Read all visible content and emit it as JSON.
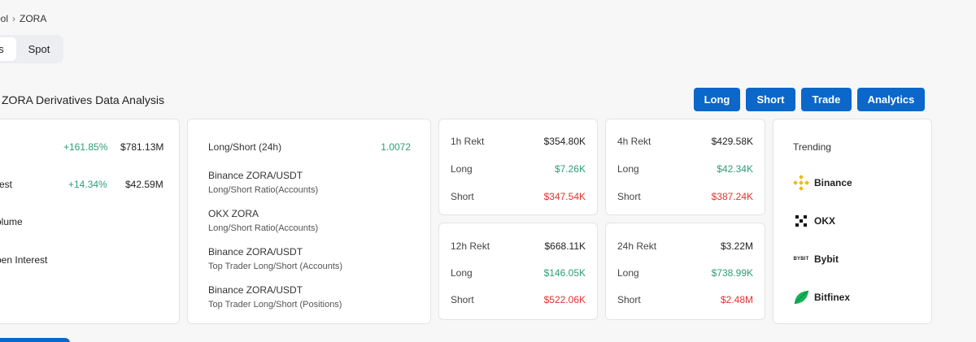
{
  "breadcrumb": {
    "parent": "ool",
    "sep": "›",
    "current": "ZORA"
  },
  "tabs": {
    "derivatives": "s",
    "spot": "Spot"
  },
  "title": "ZORA Derivatives Data Analysis",
  "buttons": {
    "long": "Long",
    "short": "Short",
    "trade": "Trade",
    "analytics": "Analytics"
  },
  "overview": [
    {
      "label": "",
      "change": "+161.85%",
      "value": "$781.13M"
    },
    {
      "label": "rest",
      "change": "+14.34%",
      "value": "$42.59M"
    },
    {
      "label": "olume"
    },
    {
      "label": "pen Interest"
    }
  ],
  "ratios": {
    "summary_label": "Long/Short (24h)",
    "summary_value": "1.0072",
    "items": [
      {
        "title": "Binance ZORA/USDT",
        "sub": "Long/Short Ratio(Accounts)"
      },
      {
        "title": "OKX ZORA",
        "sub": "Long/Short Ratio(Accounts)"
      },
      {
        "title": "Binance ZORA/USDT",
        "sub": "Top Trader Long/Short (Accounts)"
      },
      {
        "title": "Binance ZORA/USDT",
        "sub": "Top Trader Long/Short (Positions)"
      }
    ]
  },
  "rekt": {
    "h1": {
      "label": "1h Rekt",
      "total": "$354.80K",
      "long_label": "Long",
      "long": "$7.26K",
      "short_label": "Short",
      "short": "$347.54K"
    },
    "h4": {
      "label": "4h Rekt",
      "total": "$429.58K",
      "long_label": "Long",
      "long": "$42.34K",
      "short_label": "Short",
      "short": "$387.24K"
    },
    "h12": {
      "label": "12h Rekt",
      "total": "$668.11K",
      "long_label": "Long",
      "long": "$146.05K",
      "short_label": "Short",
      "short": "$522.06K"
    },
    "h24": {
      "label": "24h Rekt",
      "total": "$3.22M",
      "long_label": "Long",
      "long": "$738.99K",
      "short_label": "Short",
      "short": "$2.48M"
    }
  },
  "trending": {
    "label": "Trending",
    "exchanges": [
      {
        "name": "Binance",
        "icon": "binance-icon"
      },
      {
        "name": "OKX",
        "icon": "okx-icon"
      },
      {
        "name": "Bybit",
        "icon": "bybit-icon",
        "logo_text": "BYBIT"
      },
      {
        "name": "Bitfinex",
        "icon": "bitfinex-icon"
      }
    ]
  },
  "colors": {
    "accent": "#0b67c9",
    "positive": "#2d9d78",
    "negative": "#e5312f"
  }
}
